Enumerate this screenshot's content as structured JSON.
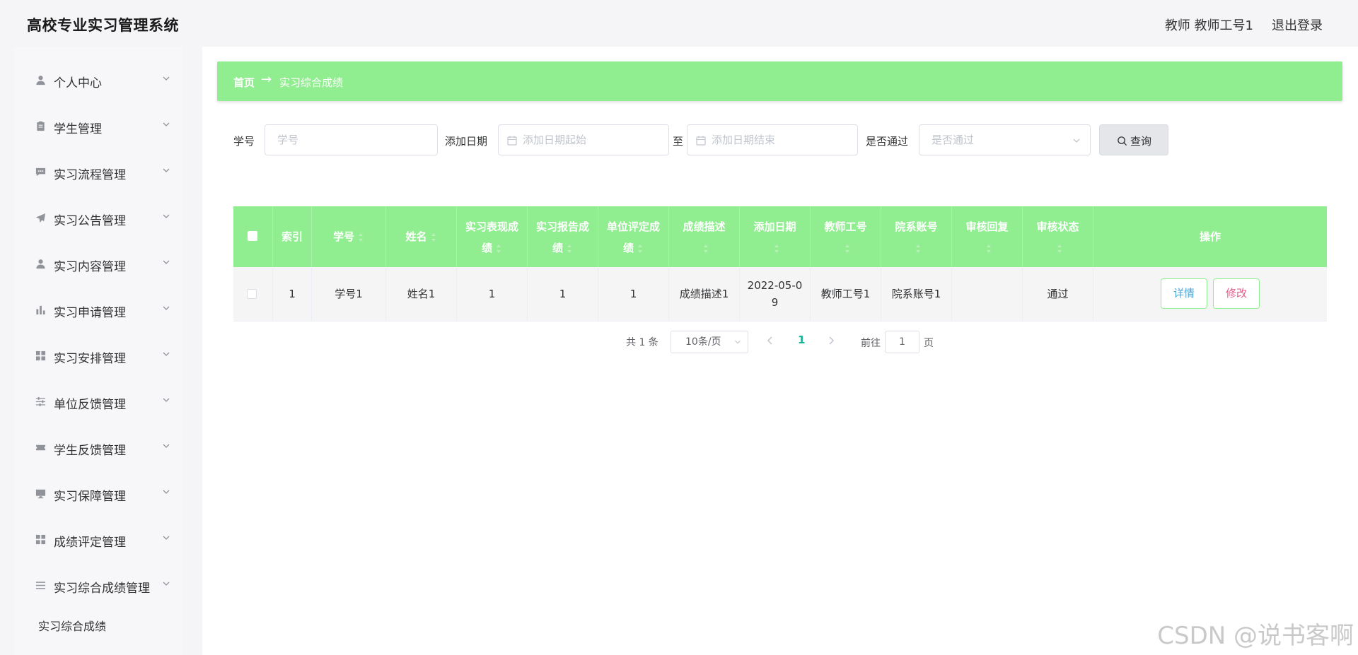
{
  "header": {
    "app_title": "高校专业实习管理系统",
    "user_info": "教师 教师工号1",
    "logout_label": "退出登录"
  },
  "sidebar": {
    "items": [
      {
        "label": "个人中心",
        "icon": "user-icon"
      },
      {
        "label": "学生管理",
        "icon": "clipboard-icon"
      },
      {
        "label": "实习流程管理",
        "icon": "chat-icon"
      },
      {
        "label": "实习公告管理",
        "icon": "send-icon"
      },
      {
        "label": "实习内容管理",
        "icon": "user-icon"
      },
      {
        "label": "实习申请管理",
        "icon": "bar-chart-icon"
      },
      {
        "label": "实习安排管理",
        "icon": "grid-icon"
      },
      {
        "label": "单位反馈管理",
        "icon": "sliders-icon"
      },
      {
        "label": "学生反馈管理",
        "icon": "ticket-icon"
      },
      {
        "label": "实习保障管理",
        "icon": "monitor-icon"
      },
      {
        "label": "成绩评定管理",
        "icon": "grid-icon"
      },
      {
        "label": "实习综合成绩管理",
        "icon": "menu-icon"
      }
    ],
    "sub_item": "实习综合成绩"
  },
  "breadcrumb": {
    "home": "首页",
    "arrow": "→",
    "current": "实习综合成绩"
  },
  "search": {
    "student_id_label": "学号",
    "student_id_placeholder": "学号",
    "date_label": "添加日期",
    "date_start_placeholder": "添加日期起始",
    "date_sep": "至",
    "date_end_placeholder": "添加日期结束",
    "pass_label": "是否通过",
    "pass_placeholder": "是否通过",
    "button_label": "查询"
  },
  "table": {
    "columns": [
      "索引",
      "学号",
      "姓名",
      "实习表现成绩",
      "实习报告成绩",
      "单位评定成绩",
      "成绩描述",
      "添加日期",
      "教师工号",
      "院系账号",
      "审核回复",
      "审核状态",
      "操作"
    ],
    "rows": [
      {
        "index": "1",
        "student_id": "学号1",
        "name": "姓名1",
        "performance": "1",
        "report": "1",
        "unit": "1",
        "desc": "成绩描述1",
        "date": "2022-05-09",
        "teacher": "教师工号1",
        "dept": "院系账号1",
        "reply": "",
        "status": "通过"
      }
    ],
    "detail_label": "详情",
    "edit_label": "修改"
  },
  "pagination": {
    "total": "共 1 条",
    "page_size": "10条/页",
    "current_page": "1",
    "goto_label": "前往",
    "goto_value": "1",
    "page_suffix": "页"
  },
  "watermark": "CSDN @说书客啊",
  "colors": {
    "accent_green": "#90ee90",
    "page_number": "#1ab394",
    "detail_text": "#4aa6d8",
    "edit_text": "#e85a8c"
  }
}
